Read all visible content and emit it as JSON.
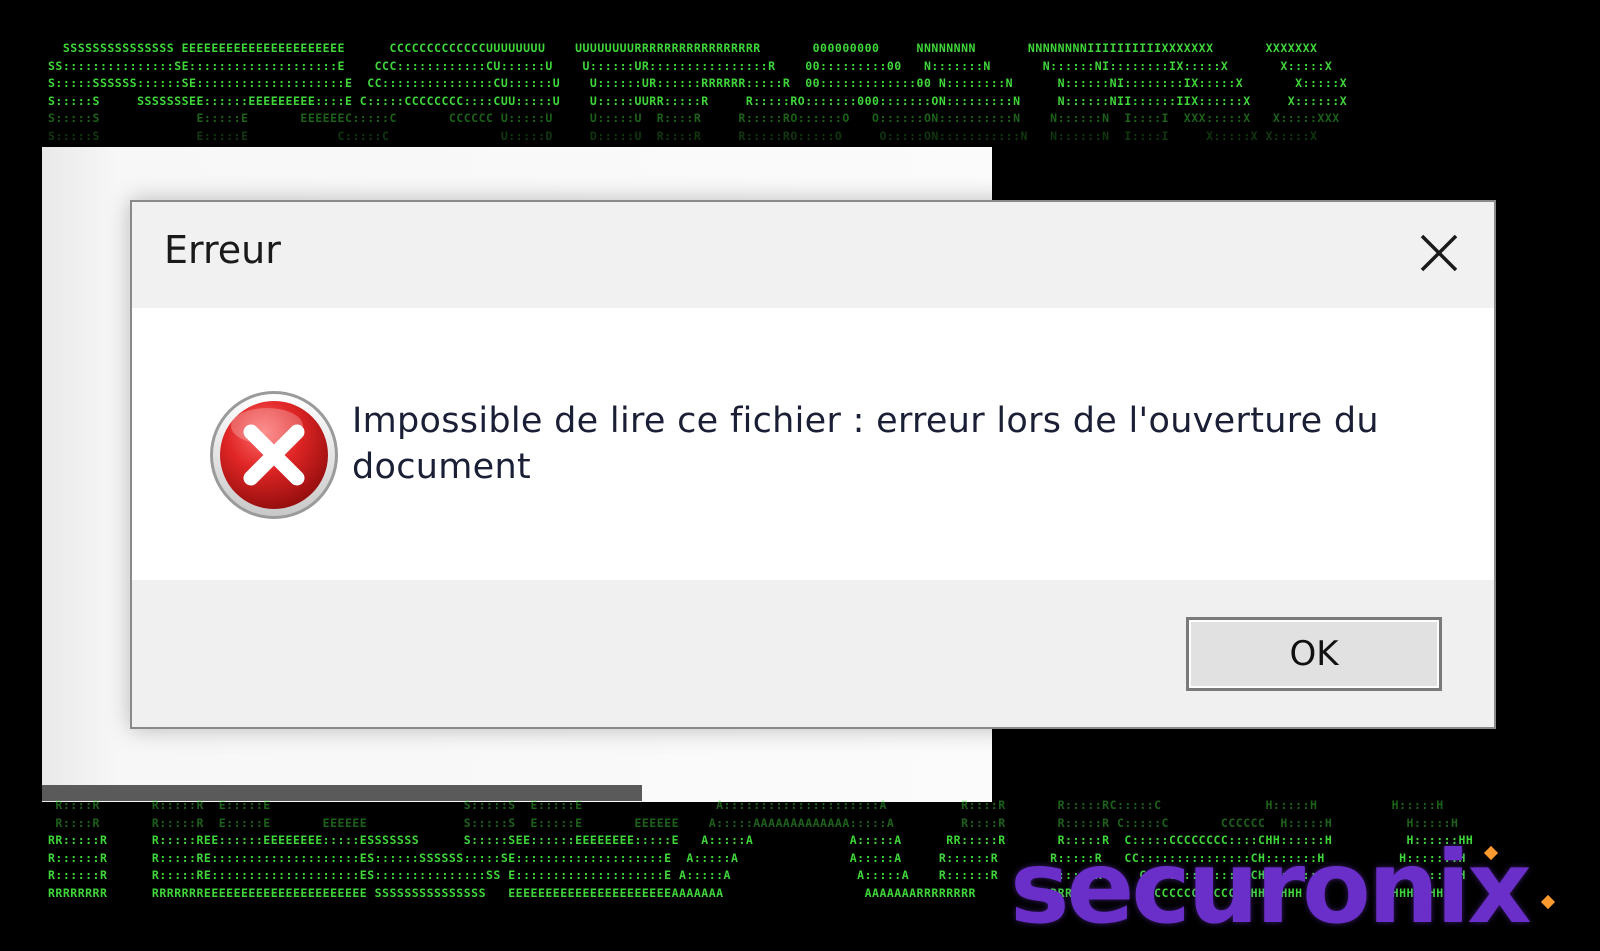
{
  "background": {
    "ascii_top": [
      "  SSSSSSSSSSSSSSS EEEEEEEEEEEEEEEEEEEEEE      CCCCCCCCCCCCCUUUUUUUU    UUUUUUUURRRRRRRRRRRRRRRRR       000000000     NNNNNNNN       NNNNNNNNIIIIIIIIIIXXXXXXX       XXXXXXX",
      "SS:::::::::::::::SE::::::::::::::::::::E    CCC::::::::::::CU::::::U    U::::::UR::::::::::::::::R    00:::::::::00   N:::::::N       N::::::NI::::::::IX:::::X       X:::::X",
      "S:::::SSSSSS::::::SE::::::::::::::::::::E  CC:::::::::::::::CU::::::U    U::::::UR::::::RRRRRR:::::R  00:::::::::::::00 N::::::::N      N::::::NI::::::::IX:::::X       X:::::X",
      "S:::::S     SSSSSSSEE::::::EEEEEEEEE::::E C:::::CCCCCCCC::::CUU:::::U    U:::::UURR:::::R     R:::::RO:::::::000:::::::ON:::::::::N     N::::::NII::::::IIX::::::X     X::::::X",
      "S:::::S             E:::::E       EEEEEEC:::::C       CCCCCC U:::::U     U:::::U  R::::R     R:::::RO::::::O   O::::::ON::::::::::N    N::::::N  I::::I  XXX:::::X   X:::::XXX",
      "S:::::S             E:::::E            C:::::C               U:::::D     D:::::U  R::::R     R:::::RO:::::O     O:::::ON:::::::::::N   N::::::N  I::::I     X:::::X X:::::X"
    ],
    "ascii_bottom": [
      " R::::R       R:::::R  E:::::E                          S:::::S  E:::::E                  A:::::::::::::::::::::A          R::::R       R:::::RC:::::C              H:::::H          H:::::H",
      " R::::R       R:::::R  E:::::E       EEEEEE             S:::::S  E:::::E       EEEEEE    A:::::AAAAAAAAAAAAA:::::A         R::::R       R:::::R C:::::C       CCCCCC  H:::::H          H:::::H",
      "RR:::::R      R:::::REE::::::EEEEEEEE:::::ESSSSSSS      S:::::SEE::::::EEEEEEEE:::::E   A:::::A             A:::::A      RR:::::R       R:::::R  C:::::CCCCCCCC::::CHH::::::H          H::::::HH",
      "R::::::R      R:::::RE::::::::::::::::::::ES::::::SSSSSS:::::SE::::::::::::::::::::E  A:::::A               A:::::A     R::::::R       R:::::R   CC:::::::::::::::CH:::::::H          H:::::::H",
      "R::::::R      R:::::RE::::::::::::::::::::ES:::::::::::::::SS E::::::::::::::::::::E A:::::A                 A:::::A    R::::::R       R:::::R     CCC::::::::::::CH:::::::H          H:::::::H",
      "RRRRRRRR      RRRRRRREEEEEEEEEEEEEEEEEEEEEE SSSSSSSSSSSSSSS   EEEEEEEEEEEEEEEEEEEEEEAAAAAAA                   AAAAAAARRRRRRRR       RRRRRRR        CCCCCCCCCCCCCHHHHHHHHH          HHHHHHHHH"
    ]
  },
  "dialog": {
    "title": "Erreur",
    "message": "Impossible de lire ce fichier : erreur lors de l'ouverture du document",
    "ok_label": "OK",
    "icon": "error-icon",
    "close_icon": "close-icon"
  },
  "brand": {
    "name": "securonix",
    "color": "#6b2fc9",
    "accent": "#ff9a2e"
  },
  "colors": {
    "ascii_green": "#3fd63a",
    "error_red": "#d42a2a"
  }
}
